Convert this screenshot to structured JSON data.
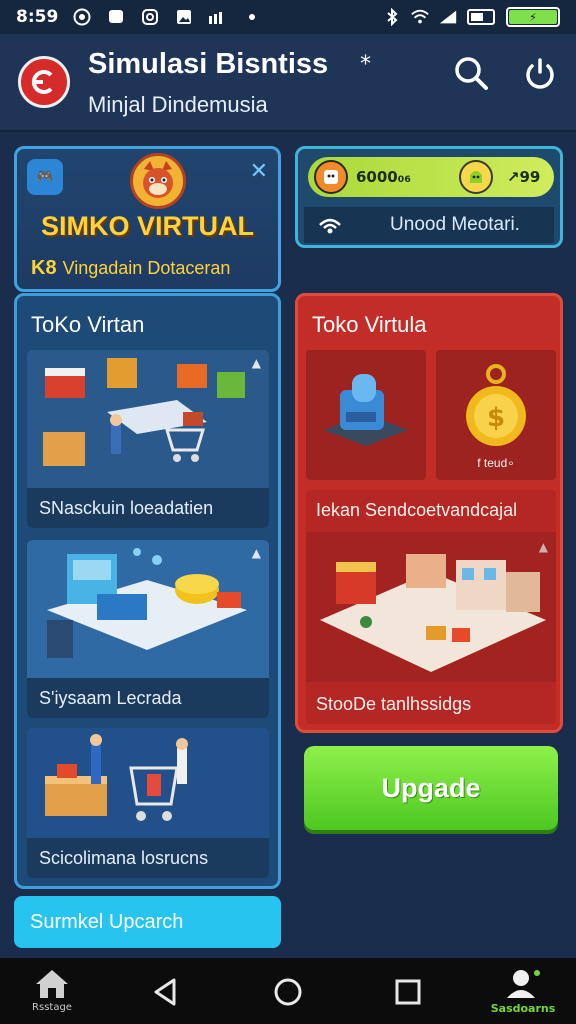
{
  "status_bar": {
    "time": "8:59",
    "battery_label": "⚡"
  },
  "header": {
    "title": "Simulasi Bisntiss",
    "subtitle": "Minjal Dindemusia"
  },
  "banner": {
    "badge": "🎮",
    "title": "SIMKO VIRTUAL",
    "sub_prefix": "K8",
    "sub_text": "Vingadain Dotaceran"
  },
  "stats": {
    "coins": "6000₀₆",
    "gems": "↗99",
    "action_label": "Unood Meotari."
  },
  "left_shop": {
    "title": "ToKo Virtan",
    "tiles": [
      {
        "caption": "SNasckuin loeadatien"
      },
      {
        "caption": "S'iysaam Lecrada"
      },
      {
        "caption": "Scicolimana losrucns"
      }
    ]
  },
  "right_shop": {
    "title": "Toko Virtula",
    "coin_tile_label": "f teud∘",
    "scene_caption_top": "Iekan Sendcoetvandcajal",
    "scene_caption_bottom": "StooDe tanlhssidgs"
  },
  "buttons": {
    "upgrade": "Upgade",
    "bottom": "Surmkel Upcarch"
  },
  "nav": {
    "home_label": "Rsstage",
    "profile_label": "Sasdoarns"
  },
  "colors": {
    "accent_green": "#4cc821",
    "accent_red": "#c32d28",
    "accent_cyan": "#27c4ef",
    "brand_gold": "#ffd23a"
  }
}
